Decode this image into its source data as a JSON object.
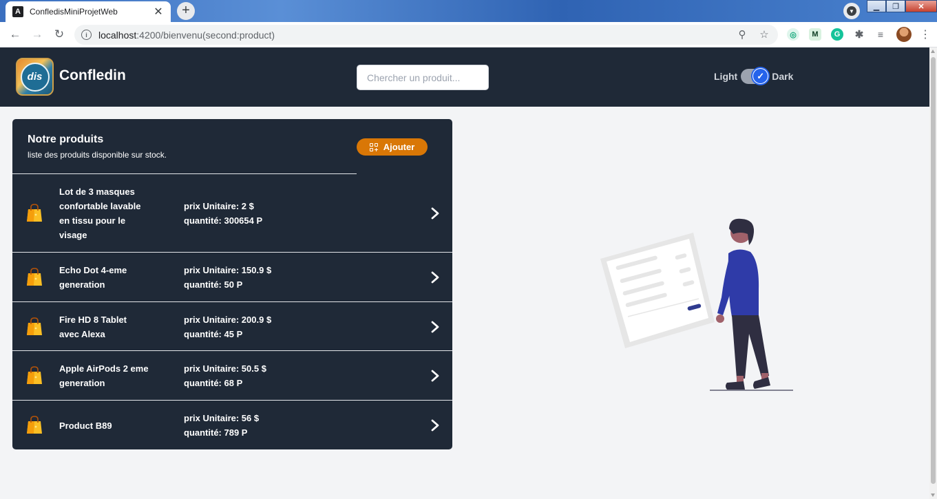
{
  "browser": {
    "tab_title": "ConfledisMiniProjetWeb",
    "tab_close": "✕",
    "new_tab": "+",
    "url_host": "localhost",
    "url_path": ":4200/bienvenu(second:product)"
  },
  "app": {
    "brand": "Confledin",
    "logo_text": "dis",
    "search_placeholder": "Chercher un produit...",
    "theme_light": "Light",
    "theme_dark": "Dark"
  },
  "products_card": {
    "title": "Notre produits",
    "subtitle": "liste des produits disponible sur stock.",
    "add_button": "Ajouter",
    "items": [
      {
        "name": "Lot de 3 masques confortable lavable en tissu pour le visage",
        "price": "prix Unitaire: 2 $",
        "quantity": "quantité: 300654 P"
      },
      {
        "name": "Echo Dot 4-eme generation",
        "price": "prix Unitaire: 150.9 $",
        "quantity": "quantité: 50 P"
      },
      {
        "name": "Fire HD 8 Tablet avec Alexa",
        "price": "prix Unitaire: 200.9 $",
        "quantity": "quantité: 45 P"
      },
      {
        "name": "Apple AirPods 2 eme generation",
        "price": "prix Unitaire: 50.5 $",
        "quantity": "quantité: 68 P"
      },
      {
        "name": "Product B89",
        "price": "prix Unitaire: 56 $",
        "quantity": "quantité: 789 P"
      }
    ]
  },
  "colors": {
    "header_bg": "#1f2937",
    "accent_orange": "#d97706",
    "toggle_blue": "#2563eb",
    "page_bg": "#f3f4f6"
  }
}
